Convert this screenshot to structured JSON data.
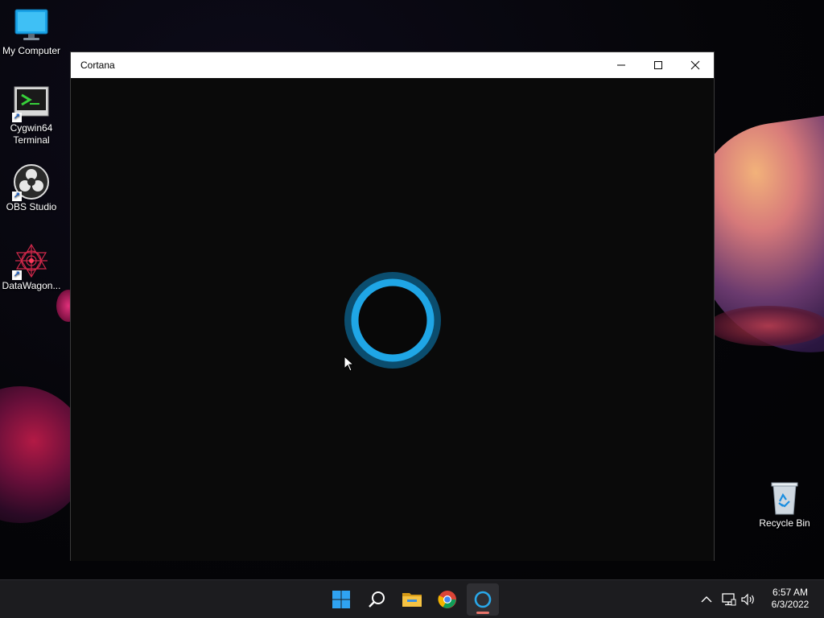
{
  "desktop": {
    "icons": [
      {
        "label": "My Computer",
        "icon": "monitor-icon"
      },
      {
        "label": "Cygwin64 Terminal",
        "icon": "terminal-icon",
        "shortcut": true
      },
      {
        "label": "OBS Studio",
        "icon": "obs-icon",
        "shortcut": true
      },
      {
        "label": "DataWagon...",
        "icon": "datawagon-icon",
        "shortcut": true
      },
      {
        "label": "Recycle Bin",
        "icon": "recycle-bin-icon"
      }
    ]
  },
  "window": {
    "title": "Cortana",
    "controls": [
      "minimize-icon",
      "maximize-icon",
      "close-icon"
    ]
  },
  "taskbar": {
    "apps": [
      {
        "name": "start",
        "icon": "windows-start-icon"
      },
      {
        "name": "search",
        "icon": "search-icon"
      },
      {
        "name": "file-explorer",
        "icon": "folder-icon"
      },
      {
        "name": "chrome",
        "icon": "chrome-icon"
      },
      {
        "name": "cortana",
        "icon": "cortana-icon",
        "active": true
      }
    ],
    "tray": {
      "icons": [
        "chevron-up-icon",
        "network-icon",
        "volume-icon"
      ],
      "time": "6:57 AM",
      "date": "6/3/2022"
    }
  },
  "colors": {
    "cortana_blue": "#0ea5e9",
    "taskbar_bg": "#1c1c1f",
    "active_indicator": "#e8756b"
  }
}
